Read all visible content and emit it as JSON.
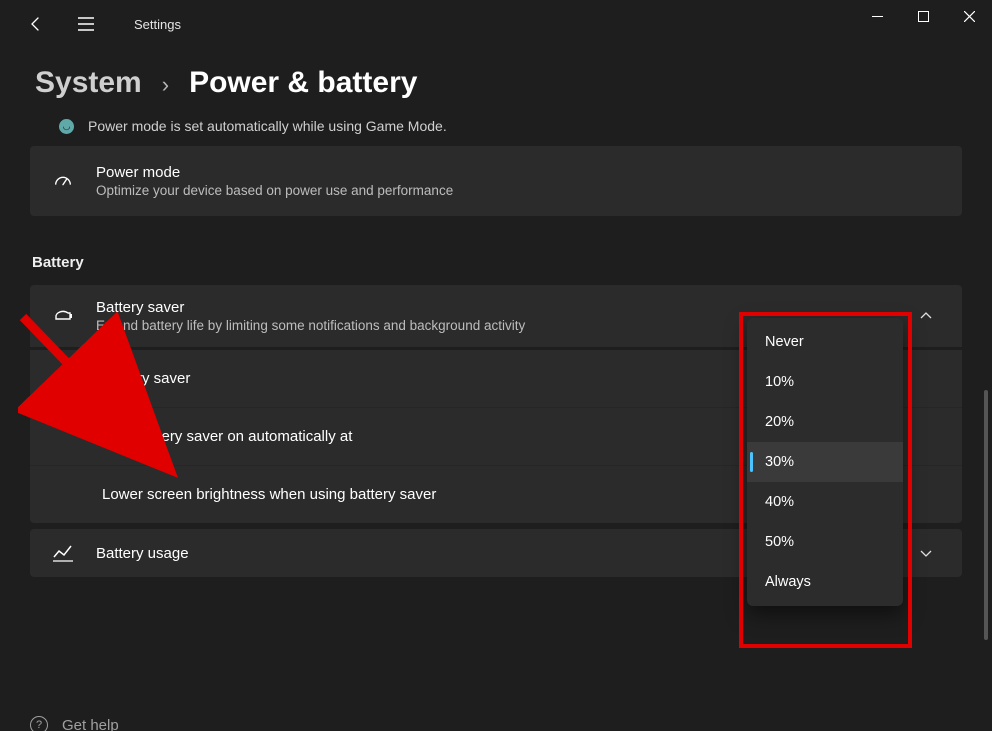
{
  "app": {
    "title": "Settings"
  },
  "breadcrumb": {
    "level1": "System",
    "separator": "›",
    "level2": "Power & battery"
  },
  "info": {
    "text": "Power mode is set automatically while using Game Mode."
  },
  "power_mode": {
    "title": "Power mode",
    "desc": "Optimize your device based on power use and performance"
  },
  "section": {
    "battery": "Battery"
  },
  "battery_saver": {
    "title": "Battery saver",
    "desc": "Extend battery life by limiting some notifications and background activity"
  },
  "sub": {
    "saver_toggle": "Battery saver",
    "auto_on": "Turn battery saver on automatically at",
    "brightness": "Lower screen brightness when using battery saver"
  },
  "battery_usage": {
    "title": "Battery usage"
  },
  "dropdown": {
    "options": [
      "Never",
      "10%",
      "20%",
      "30%",
      "40%",
      "50%",
      "Always"
    ],
    "selected": "30%"
  },
  "help": {
    "label": "Get help"
  }
}
